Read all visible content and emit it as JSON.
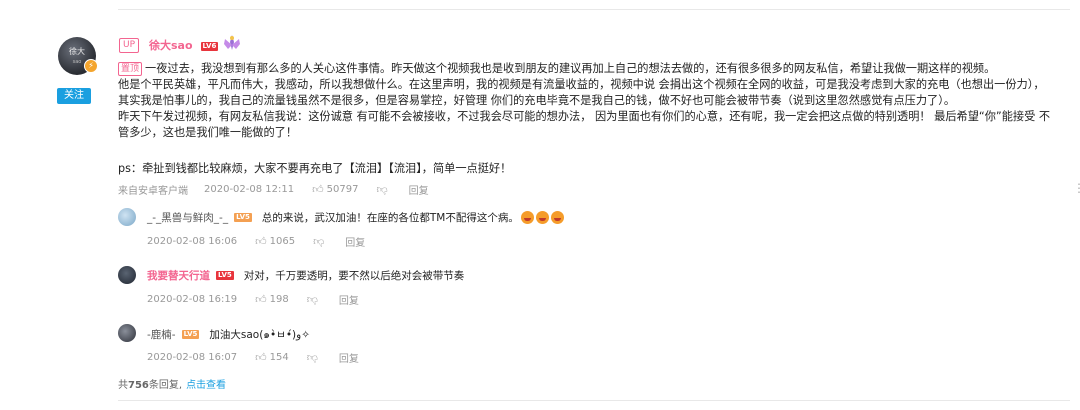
{
  "comment": {
    "avatar_text": "徐大",
    "avatar_sub": "sao",
    "follow_label": "关注",
    "up_tag": "UP",
    "username": "徐大sao",
    "level": "LV6",
    "pin_label": "置顶",
    "paragraphs": [
      "一夜过去，我没想到有那么多的人关心这件事情。昨天做这个视频我也是收到朋友的建议再加上自己的想法去做的，还有很多很多的网友私信，希望让我做一期这样的视频。",
      "他是个平民英雄，平凡而伟大，我感动，所以我想做什么。在这里声明，我的视频是有流量收益的，视频中说 会捐出这个视频在全网的收益，可是我没考虑到大家的充电（也想出一份力），其实我是怕事儿的，我自己的流量钱虽然不是很多，但是容易掌控，好管理 你们的充电毕竟不是我自己的钱，做不好也可能会被带节奏（说到这里忽然感觉有点压力了）。",
      "昨天下午发过视频，有网友私信我说：这份诚意 有可能不会被接收，不过我会尽可能的想办法， 因为里面也有你们的心意，还有呢，我一定会把这点做的特别透明！ 最后希望“你”能接受 不管多少，这也是我们唯一能做的了！"
    ],
    "ps": "ps：牵扯到钱都比较麻烦，大家不要再充电了【流泪】【流泪】，简单一点挺好！",
    "source": "来自安卓客户端",
    "time": "2020-02-08 12:11",
    "likes": "50797",
    "reply_label": "回复"
  },
  "replies": [
    {
      "name": "_-_黑兽与鲜肉_-_",
      "level": "LV5",
      "text": "总的来说，武汉加油！在座的各位都TM不配得这个病。",
      "time": "2020-02-08 16:06",
      "likes": "1065",
      "reply_label": "回复"
    },
    {
      "name": "我要替天行道",
      "level": "LV5",
      "text": "对对，千万要透明，要不然以后绝对会被带节奏",
      "time": "2020-02-08 16:19",
      "likes": "198",
      "reply_label": "回复"
    },
    {
      "name": "-鹿楠-",
      "level": "LV5",
      "text": "加油大sao(๑•̀ㅂ•́)و✧",
      "time": "2020-02-08 16:07",
      "likes": "154",
      "reply_label": "回复"
    }
  ],
  "total": {
    "prefix": "共",
    "count": "756",
    "suffix": "条回复,",
    "link": "点击查看"
  },
  "colors": {
    "accent_pink": "#f36590",
    "accent_blue": "#1a9fe0",
    "level_red": "#e8353d",
    "meta_gray": "#999999"
  },
  "icons": [
    "like-icon",
    "dislike-icon",
    "more-icon",
    "verified-icon"
  ]
}
